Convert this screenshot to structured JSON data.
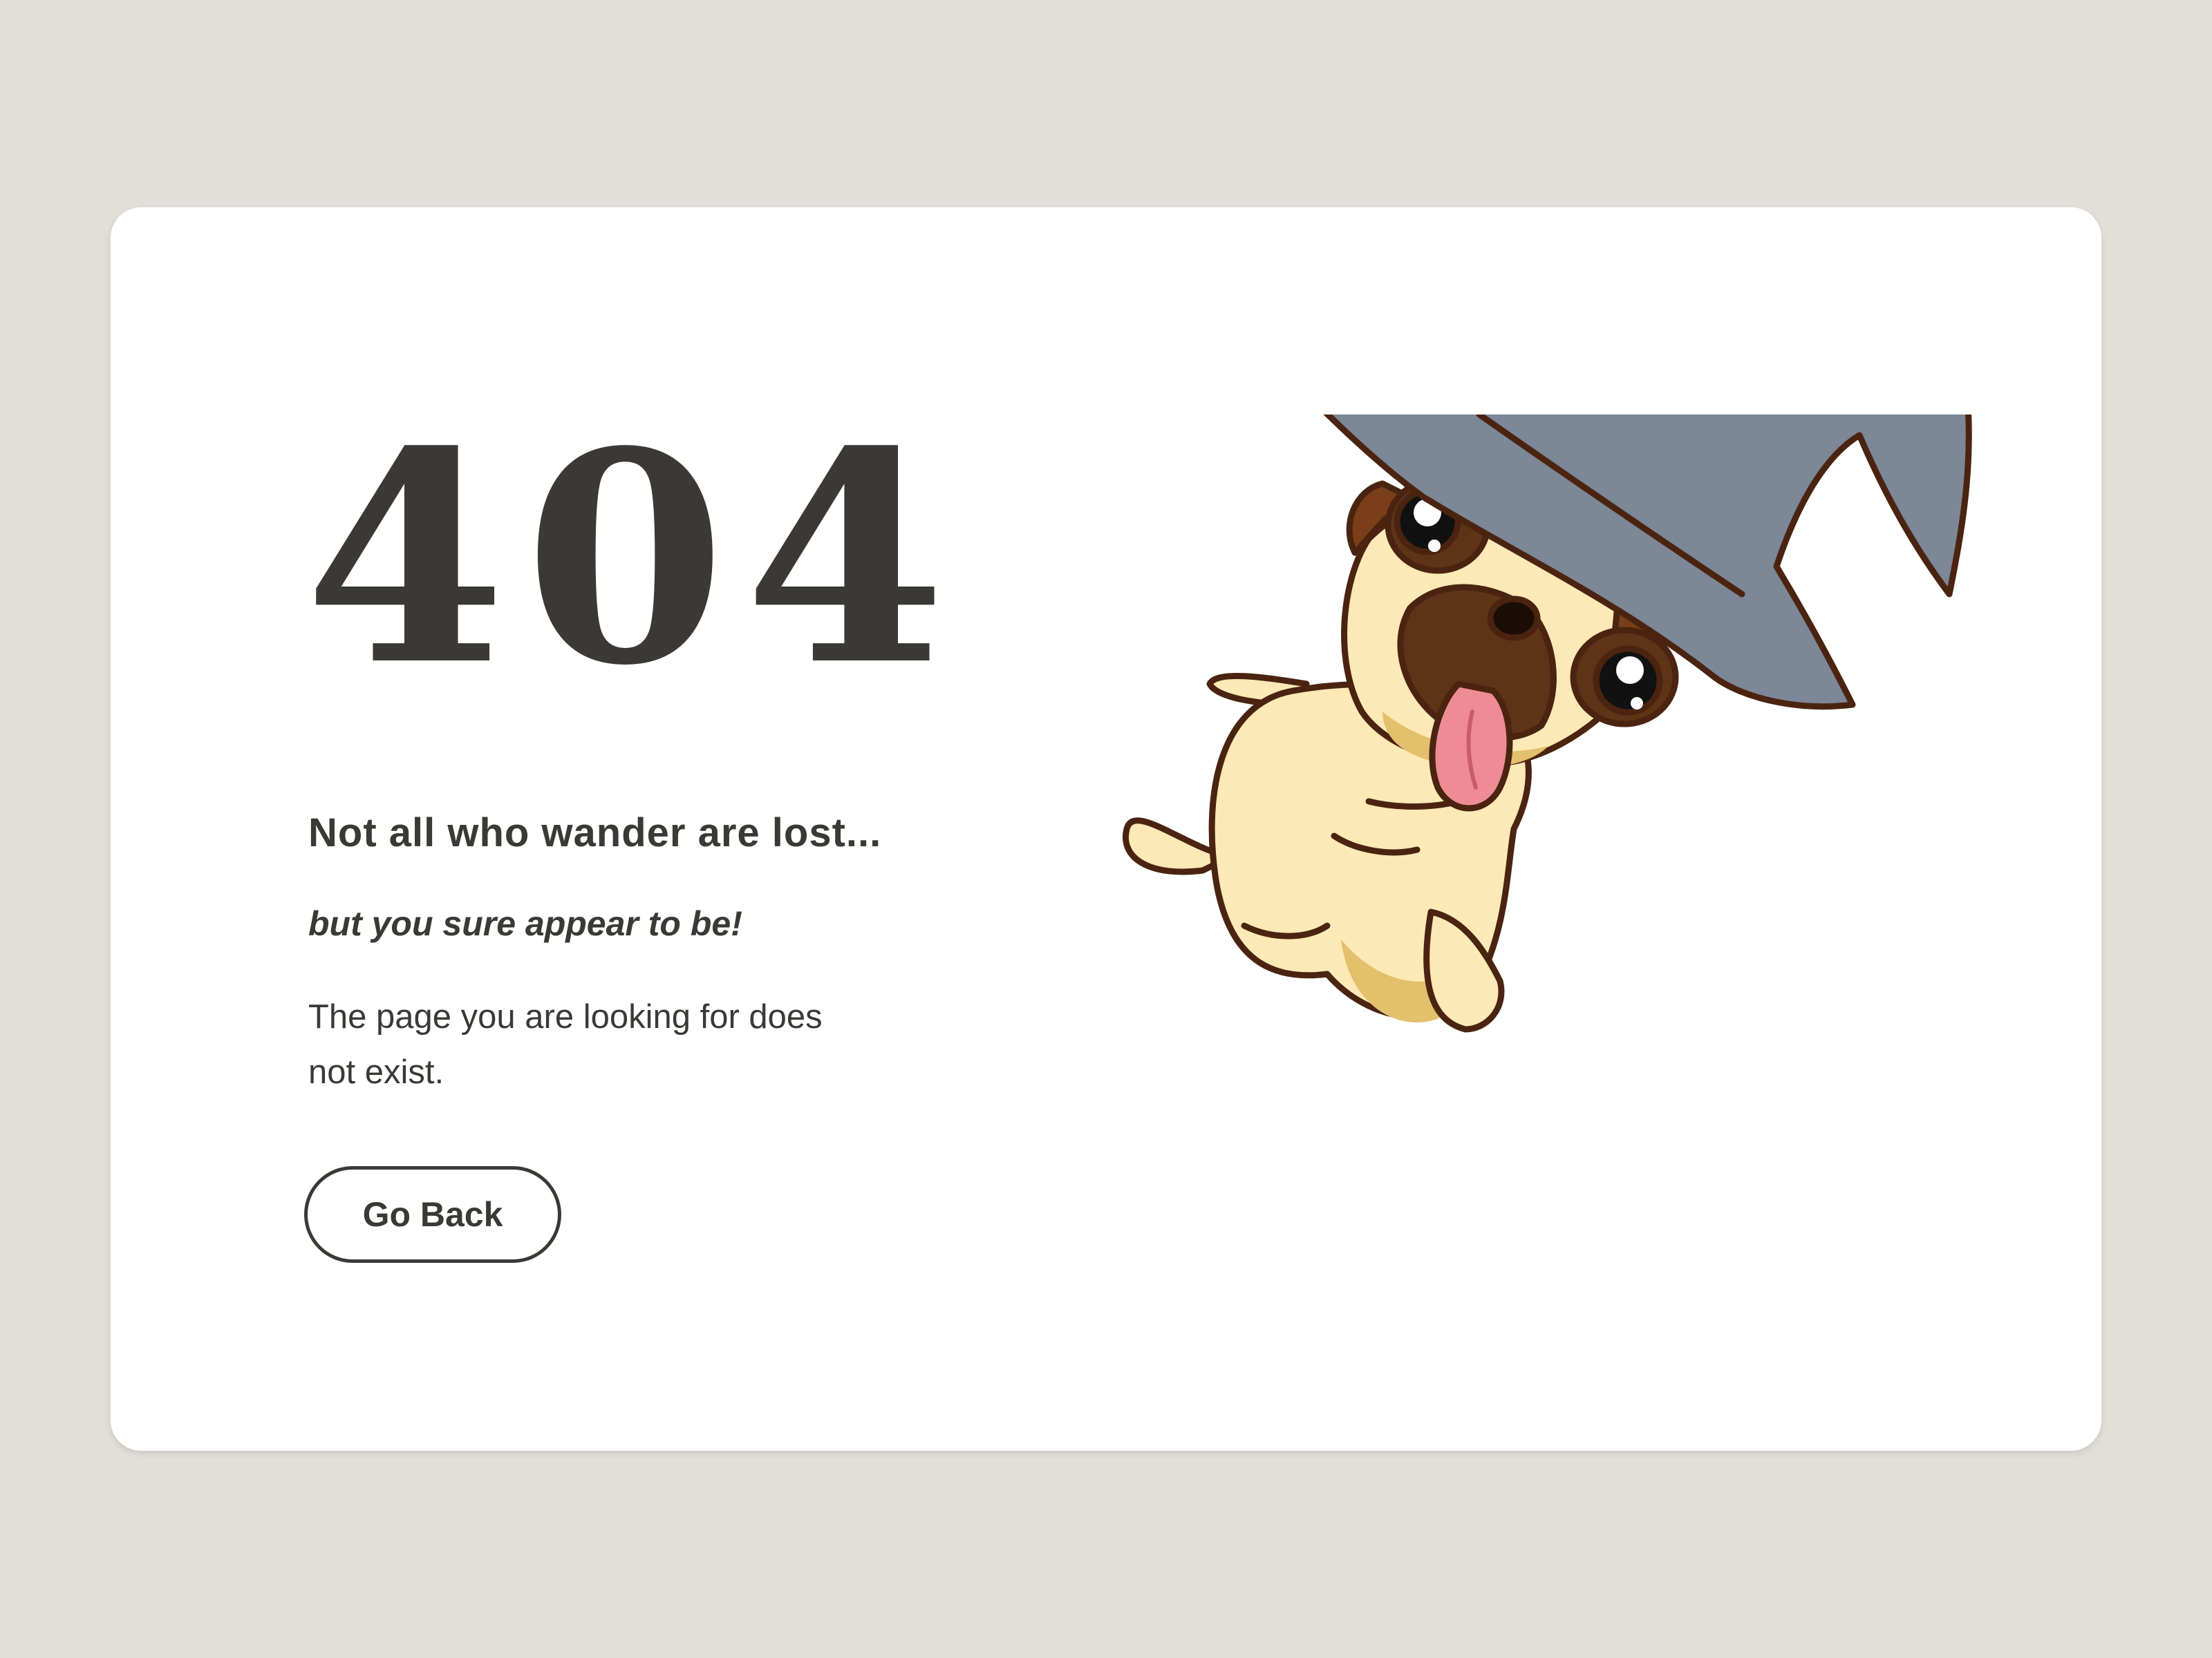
{
  "error": {
    "code": "404",
    "headline": "Not all who wander are lost...",
    "tagline": "but you sure appear to be!",
    "description": "The page you are looking for does not exist."
  },
  "actions": {
    "back_label": "Go Back"
  },
  "illustration": {
    "icon": "pug-wizard-icon"
  },
  "colors": {
    "page_background": "#e2dfda",
    "card_background": "#ffffff",
    "text": "#3a3936",
    "hat": "#7c8797",
    "pug_body": "#fde9b5",
    "pug_shade": "#e2c06c",
    "pug_mask": "#5e3417",
    "outline": "#4a2410",
    "tongue": "#ee8c96"
  }
}
